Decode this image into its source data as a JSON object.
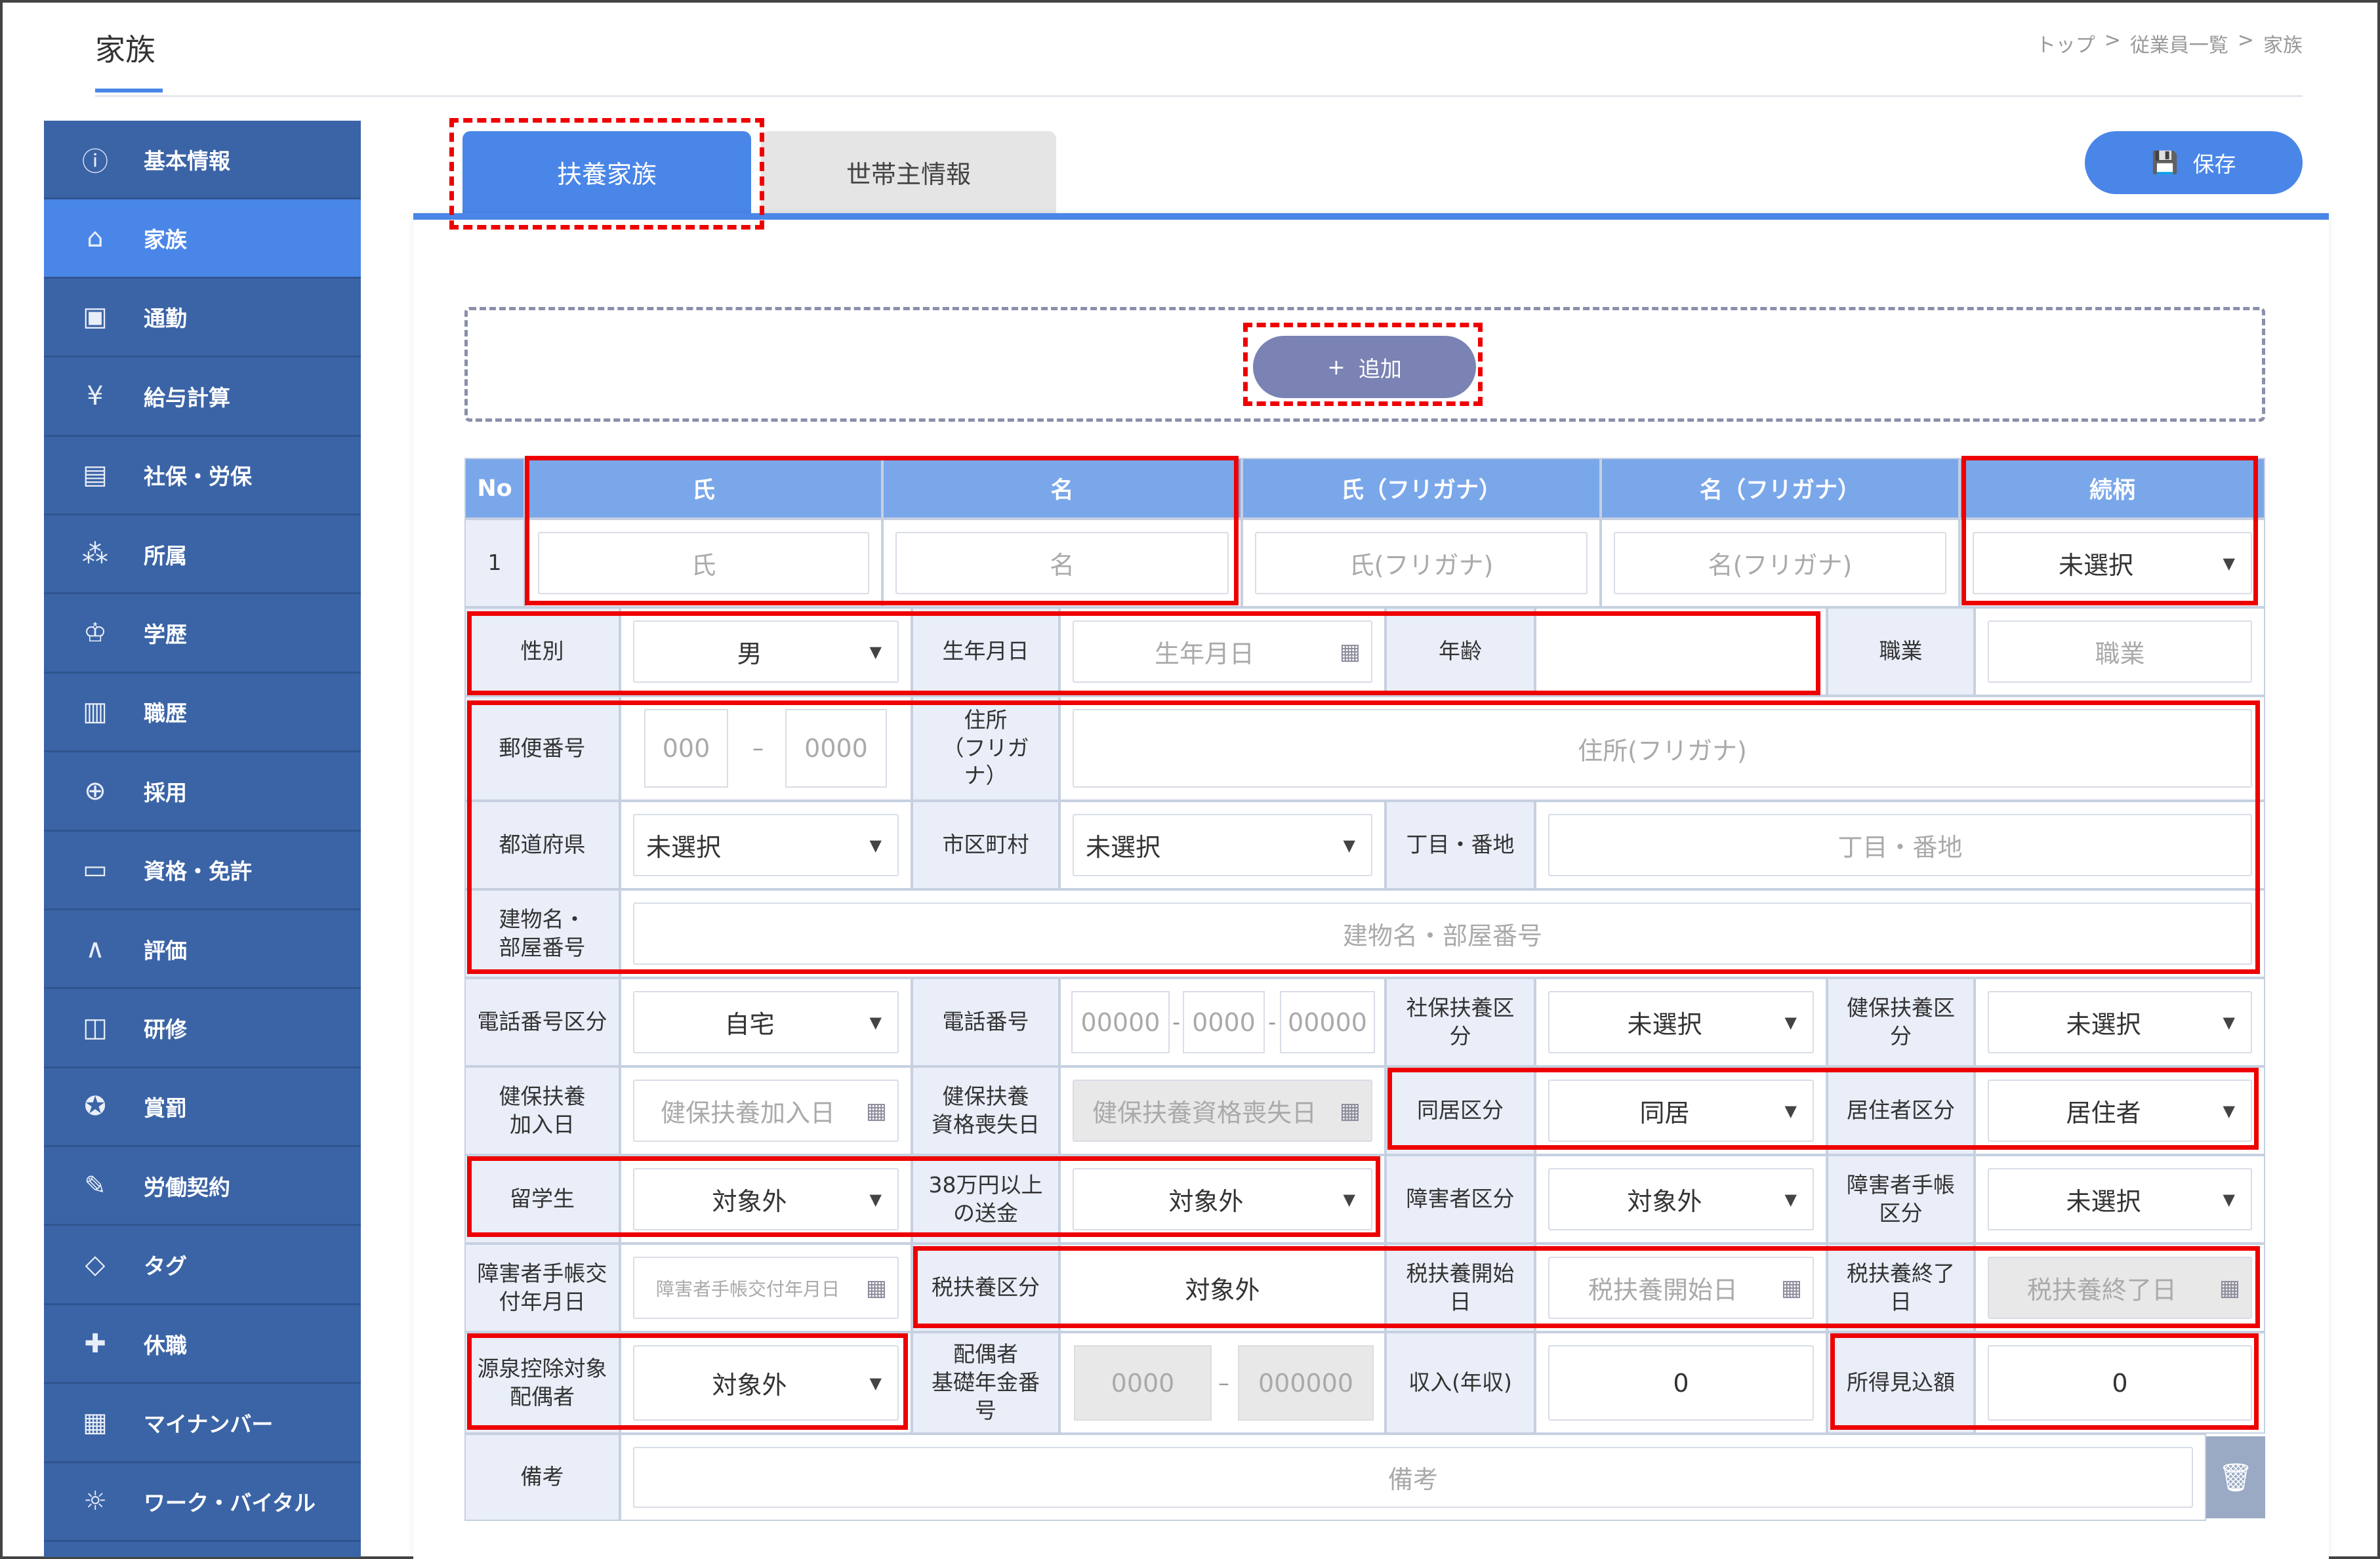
{
  "page": {
    "title": "家族",
    "breadcrumb": [
      "トップ",
      ">",
      "従業員一覧",
      ">",
      "家族"
    ]
  },
  "sidebar": {
    "items": [
      {
        "label": "基本情報",
        "icon": "info-icon"
      },
      {
        "label": "家族",
        "icon": "house-icon"
      },
      {
        "label": "通勤",
        "icon": "train-icon"
      },
      {
        "label": "給与計算",
        "icon": "yen-icon"
      },
      {
        "label": "社保・労保",
        "icon": "insurance-icon"
      },
      {
        "label": "所属",
        "icon": "org-icon"
      },
      {
        "label": "学歴",
        "icon": "graduation-icon"
      },
      {
        "label": "職歴",
        "icon": "career-icon"
      },
      {
        "label": "採用",
        "icon": "recruit-icon"
      },
      {
        "label": "資格・免許",
        "icon": "license-icon"
      },
      {
        "label": "評価",
        "icon": "evaluation-icon"
      },
      {
        "label": "研修",
        "icon": "training-icon"
      },
      {
        "label": "賞罰",
        "icon": "award-icon"
      },
      {
        "label": "労働契約",
        "icon": "contract-icon"
      },
      {
        "label": "タグ",
        "icon": "tag-icon"
      },
      {
        "label": "休職",
        "icon": "leave-icon"
      },
      {
        "label": "マイナンバー",
        "icon": "mynumber-icon"
      },
      {
        "label": "ワーク・バイタル",
        "icon": "vital-icon"
      }
    ]
  },
  "tabs": [
    "扶養家族",
    "世帯主情報"
  ],
  "toolbar": {
    "save": "保存",
    "add": "追加",
    "add_icon": "+"
  },
  "table": {
    "headers": [
      "No",
      "氏",
      "名",
      "氏（フリガナ）",
      "名（フリガナ）",
      "続柄"
    ],
    "row_no": "1"
  },
  "labels": {
    "gender": "性別",
    "birthday": "生年月日",
    "age": "年齢",
    "job": "職業",
    "zip": "郵便番号",
    "address_kana": "住所\n（フリガ\nナ）",
    "pref": "都道府県",
    "city": "市区町村",
    "street": "丁目・番地",
    "building": "建物名・\n部屋番号",
    "phone_type": "電話番号区分",
    "phone": "電話番号",
    "shaho": "社保扶養区\n分",
    "kenpo": "健保扶養区\n分",
    "kenpo_join": "健保扶養\n加入日",
    "kenpo_loss": "健保扶養\n資格喪失日",
    "cohabit": "同居区分",
    "resident": "居住者区分",
    "student": "留学生",
    "remit": "38万円以上\nの送金",
    "disability": "障害者区分",
    "disability_book": "障害者手帳\n区分",
    "disability_date": "障害者手帳交\n付年月日",
    "tax_dep": "税扶養区分",
    "tax_start": "税扶養開始\n日",
    "tax_end": "税扶養終了\n日",
    "withholding": "源泉控除対象\n配偶者",
    "pension": "配偶者\n基礎年金番\n号",
    "income": "収入(年収)",
    "income_est": "所得見込額",
    "note": "備考"
  },
  "placeholders": {
    "sei": "氏",
    "mei": "名",
    "sei_kana": "氏(フリガナ)",
    "mei_kana": "名(フリガナ)",
    "birthday": "生年月日",
    "job": "職業",
    "zip1": "000",
    "zip2": "0000",
    "address_kana": "住所(フリガナ)",
    "street": "丁目・番地",
    "building": "建物名・部屋番号",
    "phone1": "00000",
    "phone2": "0000",
    "phone3": "00000",
    "kenpo_join": "健保扶養加入日",
    "kenpo_loss": "健保扶養資格喪失日",
    "disability_date": "障害者手帳交付年月日",
    "tax_start": "税扶養開始日",
    "tax_end": "税扶養終了日",
    "pension1": "0000",
    "pension2": "000000",
    "note": "備考"
  },
  "values": {
    "relation": "未選択",
    "gender": "男",
    "pref": "未選択",
    "city": "未選択",
    "phone_type": "自宅",
    "shaho": "未選択",
    "kenpo": "未選択",
    "cohabit": "同居",
    "resident": "居住者",
    "student": "対象外",
    "remit": "対象外",
    "disability": "対象外",
    "disability_book": "未選択",
    "tax_dep": "対象外",
    "withholding": "対象外",
    "income": "0",
    "income_est": "0"
  },
  "icons": {
    "save": "save-icon",
    "trash": "trash-icon",
    "calendar": "calendar-icon",
    "dropdown": "chevron-down-icon"
  },
  "colors": {
    "accent": "#4a86e8",
    "sidebar": "#3b64a6",
    "highlight": "#e00000"
  }
}
